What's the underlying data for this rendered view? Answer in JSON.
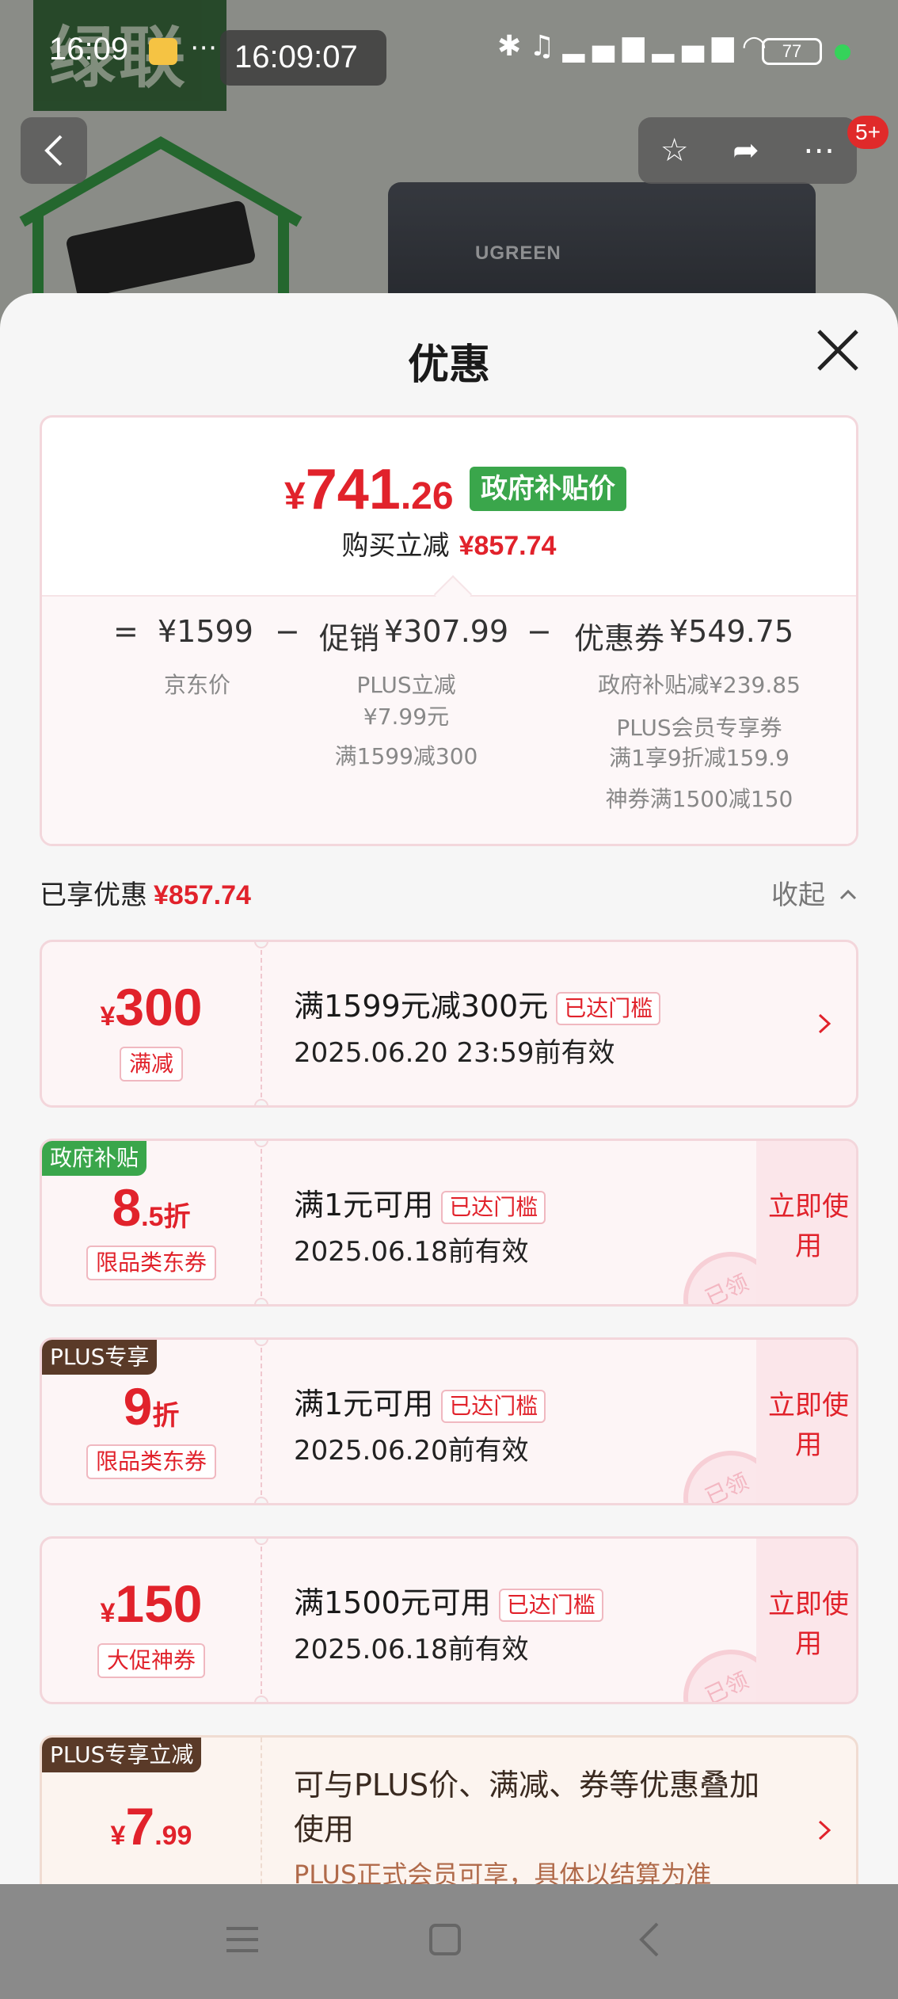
{
  "status_bar": {
    "time": "16:09",
    "clock_overlay": "16:09:07",
    "battery": "77"
  },
  "background": {
    "logo_text": "绿联",
    "product_brand": "UGREEN"
  },
  "badge": "5+",
  "sheet": {
    "title": "优惠"
  },
  "price_summary": {
    "currency": "¥",
    "final_price_int": "741",
    "final_price_dec": ".26",
    "tag": "政府补贴价",
    "buy_label": "购买立减",
    "buy_amount": "¥857.74",
    "eq_sign": "=",
    "minus": "−",
    "jd_price": "¥1599",
    "jd_label": "京东价",
    "promo_label": "促销",
    "promo_amount": "¥307.99",
    "promo_detail_1": "PLUS立减",
    "promo_detail_2": "¥7.99元",
    "promo_detail_3": "满1599减300",
    "coupon_label": "优惠券",
    "coupon_amount": "¥549.75",
    "coupon_detail_1": "政府补贴减¥239.85",
    "coupon_detail_2": "PLUS会员专享券",
    "coupon_detail_3": "满1享9折减159.9",
    "coupon_detail_4": "神券满1500减150"
  },
  "enjoyed": {
    "label": "已享优惠",
    "amount": "¥857.74",
    "collapse": "收起"
  },
  "coupons": [
    {
      "symbol": "¥",
      "amount": "300",
      "type": "满减",
      "title": "满1599元减300元",
      "tag": "已达门槛",
      "date": "2025.06.20 23:59前有效"
    },
    {
      "corner": "政府补贴",
      "amount_big": "8",
      "amount_small": ".5折",
      "type": "限品类东券",
      "title": "满1元可用",
      "tag": "已达门槛",
      "date": "2025.06.18前有效",
      "action": "立即使用",
      "stamp": "已领"
    },
    {
      "corner": "PLUS专享",
      "amount_big": "9",
      "amount_small": "折",
      "type": "限品类东券",
      "title": "满1元可用",
      "tag": "已达门槛",
      "date": "2025.06.20前有效",
      "action": "立即使用",
      "stamp": "已领"
    },
    {
      "symbol": "¥",
      "amount": "150",
      "type": "大促神券",
      "title": "满1500元可用",
      "tag": "已达门槛",
      "date": "2025.06.18前有效",
      "action": "立即使用",
      "stamp": "已领"
    }
  ],
  "plus_card": {
    "corner": "PLUS专享立减",
    "symbol": "¥",
    "amount_big": "7",
    "amount_small": ".99",
    "description": "可与PLUS价、满减、券等优惠叠加使用",
    "sub": "PLUS正式会员可享，具体以结算为准"
  },
  "colors": {
    "accent_red": "#e1222b",
    "gov_green": "#3aa64b",
    "plus_brown": "#5a3a28"
  }
}
